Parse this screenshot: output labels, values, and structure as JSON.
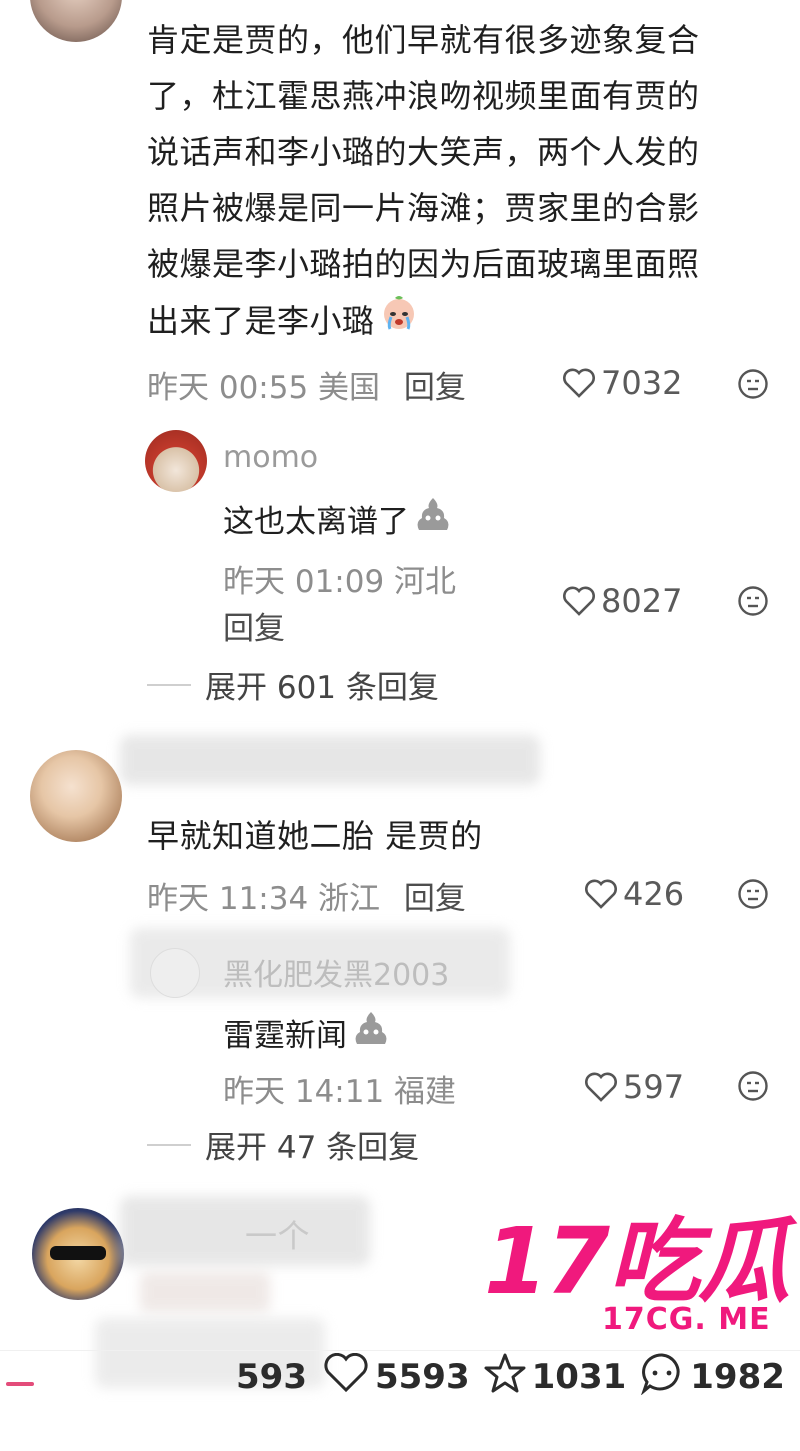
{
  "comments": [
    {
      "text_lines": [
        "肯定是贾的，他们早就有很多迹象复合",
        "了，杜江霍思燕冲浪吻视频里面有贾的",
        "说话声和李小璐的大笑声，两个人发的",
        "照片被爆是同一片海滩；贾家里的合影",
        "被爆是李小璐拍的因为后面玻璃里面照",
        "出来了是李小璐"
      ],
      "time_location": "昨天 00:55 美国",
      "reply_label": "回复",
      "likes": "7032",
      "reply": {
        "username": "momo",
        "text": "这也太离谱了",
        "time_location": "昨天 01:09 河北",
        "reply_label": "回复",
        "likes": "8027"
      },
      "expand_label": "展开 601 条回复"
    },
    {
      "text": "早就知道她二胎 是贾的",
      "time_location": "昨天 11:34 浙江",
      "reply_label": "回复",
      "likes": "426",
      "reply": {
        "username": "黑化肥发黑2003",
        "text": "雷霆新闻",
        "time_location": "昨天 14:11 福建",
        "likes": "597"
      },
      "expand_label": "展开 47 条回复"
    },
    {
      "text": "一个"
    }
  ],
  "bottom_bar": {
    "partial_count": "593",
    "likes": "5593",
    "favorites": "1031",
    "comments": "1982"
  },
  "watermark": {
    "big": "17吃瓜",
    "small": "17CG. ME"
  },
  "colors": {
    "watermark_pink": "#f0197d",
    "meta_gray": "#8d8d8d"
  }
}
